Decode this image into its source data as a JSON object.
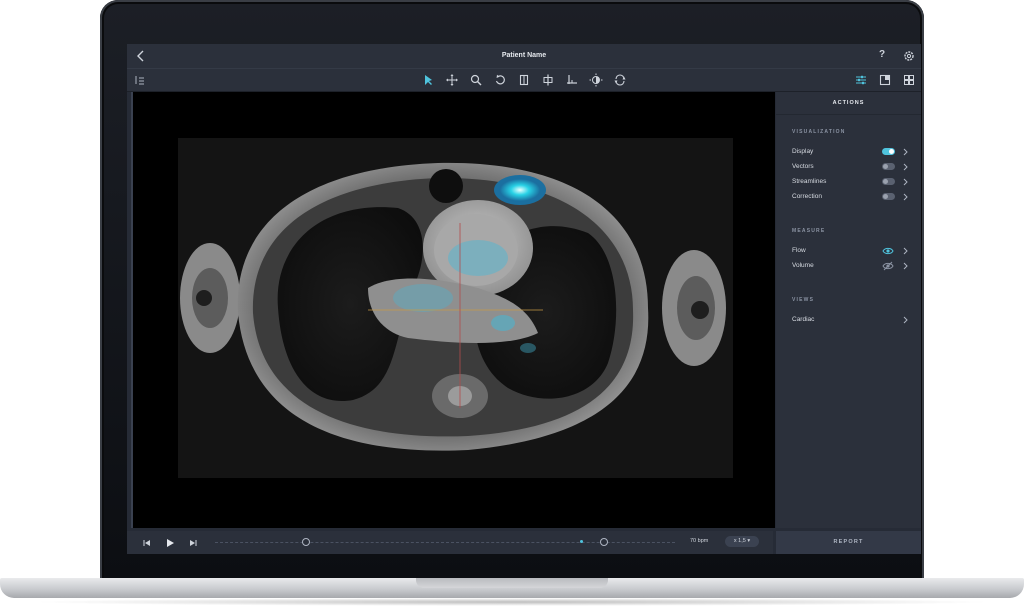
{
  "titlebar": {
    "title": "Patient Name",
    "help": "?"
  },
  "toolbar": {
    "left_icon": "list-icon",
    "tools": [
      "pointer-icon",
      "move-icon",
      "zoom-icon",
      "rotate-icon",
      "flip-icon",
      "split-icon",
      "axis-icon",
      "contrast-icon",
      "reset-icon"
    ],
    "right_icons": [
      "sliders-icon",
      "layout-icon",
      "grid-icon"
    ],
    "accent": "#4fc3dd"
  },
  "panel": {
    "header": "ACTIONS",
    "visualization": {
      "title": "VISUALIZATION",
      "items": [
        {
          "label": "Display",
          "on": true
        },
        {
          "label": "Vectors",
          "on": false
        },
        {
          "label": "Streamlines",
          "on": false
        },
        {
          "label": "Correction",
          "on": false
        }
      ]
    },
    "measure": {
      "title": "MEASURE",
      "items": [
        {
          "label": "Flow",
          "visible": true
        },
        {
          "label": "Volume",
          "visible": false
        }
      ]
    },
    "views": {
      "title": "VIEWS",
      "items": [
        {
          "label": "Cardiac"
        }
      ]
    }
  },
  "playback": {
    "bpm": "70 bpm",
    "speed": "x 1,5"
  },
  "report_label": "REPORT"
}
